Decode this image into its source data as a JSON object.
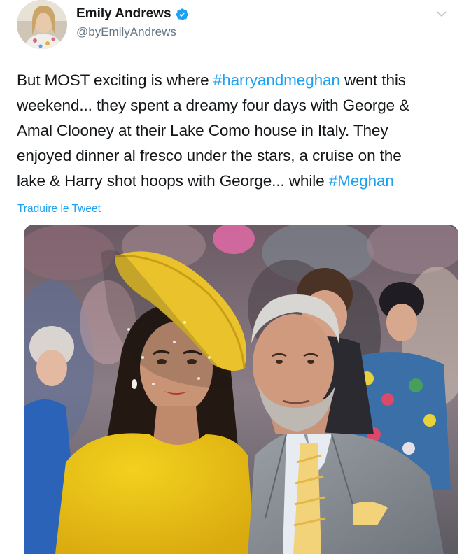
{
  "author": {
    "display_name": "Emily Andrews",
    "handle": "@byEmilyAndrews",
    "verified_icon": "verified-badge-icon"
  },
  "tweet": {
    "lines": [
      [
        {
          "t": "But MOST exciting is where ",
          "h": false
        },
        {
          "t": "#harryandmeghan",
          "h": true
        },
        {
          "t": " went this",
          "h": false
        }
      ],
      [
        {
          "t": "weekend... they spent a dreamy four days with George &",
          "h": false
        }
      ],
      [
        {
          "t": "Amal Clooney at their Lake Como house in Italy. They",
          "h": false
        }
      ],
      [
        {
          "t": "enjoyed dinner al fresco under the stars, a cruise on the",
          "h": false
        }
      ],
      [
        {
          "t": "lake & Harry shot hoops with George... while ",
          "h": false
        },
        {
          "t": "#Meghan",
          "h": true
        }
      ]
    ],
    "translate_label": "Traduire le Tweet"
  },
  "colors": {
    "link": "#1da1f2",
    "text": "#14171a",
    "secondary": "#657786"
  }
}
